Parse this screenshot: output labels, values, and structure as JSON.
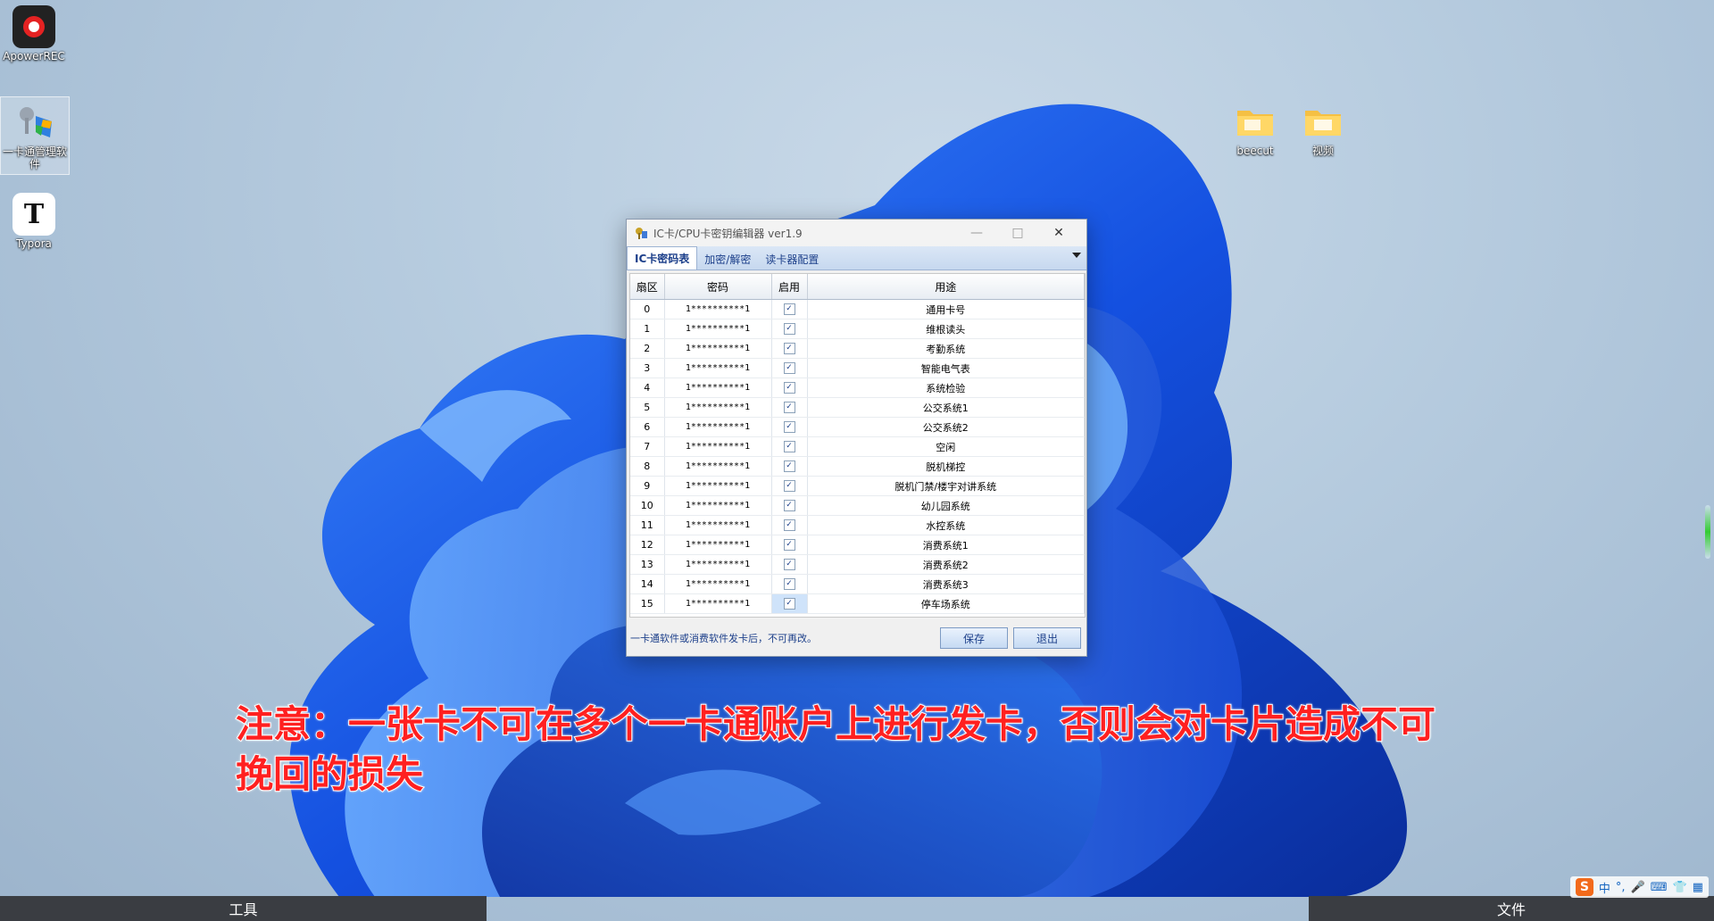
{
  "desktop": {
    "icons": [
      {
        "label": "ApowerREC"
      },
      {
        "label": "一卡通管理软件"
      },
      {
        "label": "Typora"
      },
      {
        "label": "beecut"
      },
      {
        "label": "视频"
      }
    ]
  },
  "dialog": {
    "title": "IC卡/CPU卡密钥编辑器 ver1.9",
    "tabs": [
      "IC卡密码表",
      "加密/解密",
      "读卡器配置"
    ],
    "columns": [
      "扇区",
      "密码",
      "启用",
      "用途"
    ],
    "rows": [
      {
        "sector": "0",
        "password": "1**********1",
        "enabled": true,
        "usage": "通用卡号"
      },
      {
        "sector": "1",
        "password": "1**********1",
        "enabled": true,
        "usage": "维根读头"
      },
      {
        "sector": "2",
        "password": "1**********1",
        "enabled": true,
        "usage": "考勤系统"
      },
      {
        "sector": "3",
        "password": "1**********1",
        "enabled": true,
        "usage": "智能电气表"
      },
      {
        "sector": "4",
        "password": "1**********1",
        "enabled": true,
        "usage": "系统检验"
      },
      {
        "sector": "5",
        "password": "1**********1",
        "enabled": true,
        "usage": "公交系统1"
      },
      {
        "sector": "6",
        "password": "1**********1",
        "enabled": true,
        "usage": "公交系统2"
      },
      {
        "sector": "7",
        "password": "1**********1",
        "enabled": true,
        "usage": "空闲"
      },
      {
        "sector": "8",
        "password": "1**********1",
        "enabled": true,
        "usage": "脱机梯控"
      },
      {
        "sector": "9",
        "password": "1**********1",
        "enabled": true,
        "usage": "脱机门禁/楼宇对讲系统"
      },
      {
        "sector": "10",
        "password": "1**********1",
        "enabled": true,
        "usage": "幼儿园系统"
      },
      {
        "sector": "11",
        "password": "1**********1",
        "enabled": true,
        "usage": "水控系统"
      },
      {
        "sector": "12",
        "password": "1**********1",
        "enabled": true,
        "usage": "消费系统1"
      },
      {
        "sector": "13",
        "password": "1**********1",
        "enabled": true,
        "usage": "消费系统2"
      },
      {
        "sector": "14",
        "password": "1**********1",
        "enabled": true,
        "usage": "消费系统3"
      },
      {
        "sector": "15",
        "password": "1**********1",
        "enabled": true,
        "usage": "停车场系统"
      }
    ],
    "footer_note": "一卡通软件或消费软件发卡后，不可再改。",
    "save_label": "保存",
    "exit_label": "退出"
  },
  "caption": {
    "line1": "注意：一张卡不可在多个一卡通账户上进行发卡，否则会对卡片造成不可",
    "line2": "挽回的损失"
  },
  "bottom_bar": {
    "left_label": "工具",
    "right_label": "文件"
  },
  "tray": {
    "ime_lang": "中",
    "punct": "°,"
  },
  "colors": {
    "caption_red": "#ff2020",
    "wallpaper_blue": "#1a5fe0",
    "tab_text": "#1c3f8a"
  }
}
